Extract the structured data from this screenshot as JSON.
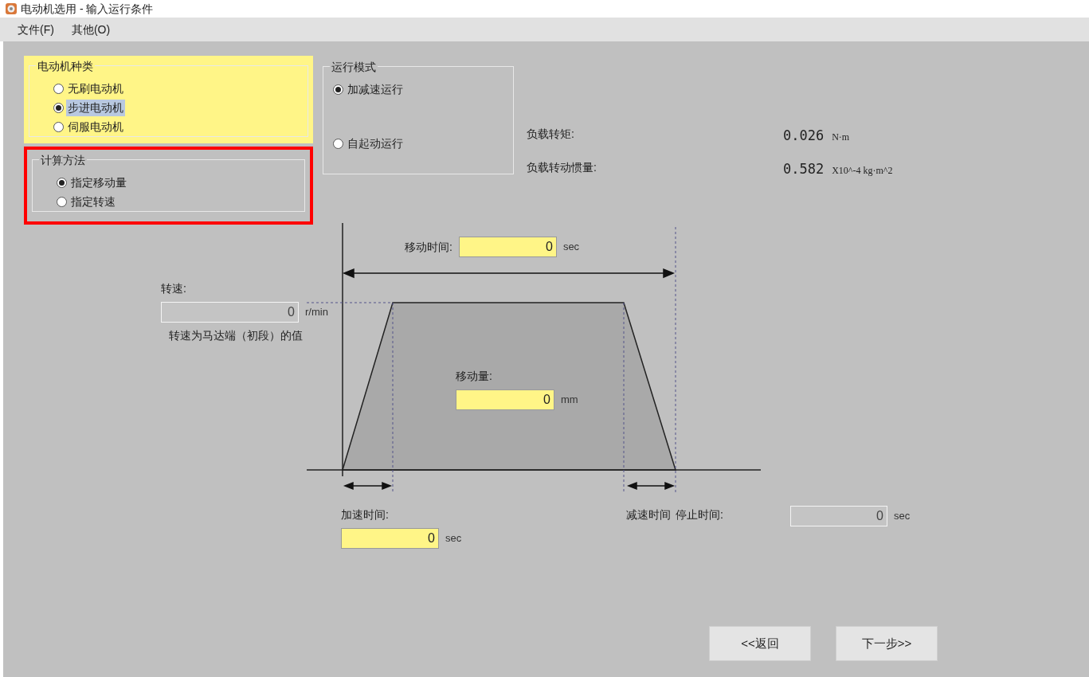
{
  "window": {
    "title": "电动机选用 - 输入运行条件"
  },
  "menu": [
    {
      "label": "文件(F)"
    },
    {
      "label": "其他(O)"
    }
  ],
  "motor_type": {
    "title": "电动机种类",
    "options": [
      {
        "label": "无刷电动机",
        "selected": false,
        "focused": false
      },
      {
        "label": "步进电动机",
        "selected": true,
        "focused": true
      },
      {
        "label": "伺服电动机",
        "selected": false,
        "focused": false
      }
    ]
  },
  "calc_method": {
    "title": "计算方法",
    "highlighted": true,
    "options": [
      {
        "label": "指定移动量",
        "selected": true,
        "focused": false
      },
      {
        "label": "指定转速",
        "selected": false,
        "focused": false
      }
    ]
  },
  "run_mode": {
    "title": "运行模式",
    "options": [
      {
        "label": "加减速运行",
        "selected": true,
        "focused": false
      },
      {
        "label": "自起动运行",
        "selected": false,
        "focused": false
      }
    ]
  },
  "load": [
    {
      "label": "负载转矩:",
      "value": "0.026",
      "unit": "N·m"
    },
    {
      "label": "负载转动惯量:",
      "value": "0.582",
      "unit": "X10^-4 kg·m^2"
    }
  ],
  "diagram": {
    "move_time": {
      "label": "移动时间:",
      "value": "0",
      "unit": "sec",
      "disabled": false
    },
    "speed": {
      "label": "转速:",
      "value": "0",
      "unit": "r/min",
      "disabled": true,
      "note": "转速为马达端（初段）的值"
    },
    "move_distance": {
      "label": "移动量:",
      "value": "0",
      "unit": "mm",
      "disabled": false
    },
    "accel_time": {
      "label": "加速时间:",
      "value": "0",
      "unit": "sec",
      "disabled": false
    },
    "decel_time": {
      "label": "减速时间"
    },
    "stop_time": {
      "label": "停止时间:",
      "value": "0",
      "unit": "sec",
      "disabled": true
    }
  },
  "buttons": [
    {
      "label": "<<返回"
    },
    {
      "label": "下一步>>"
    }
  ]
}
